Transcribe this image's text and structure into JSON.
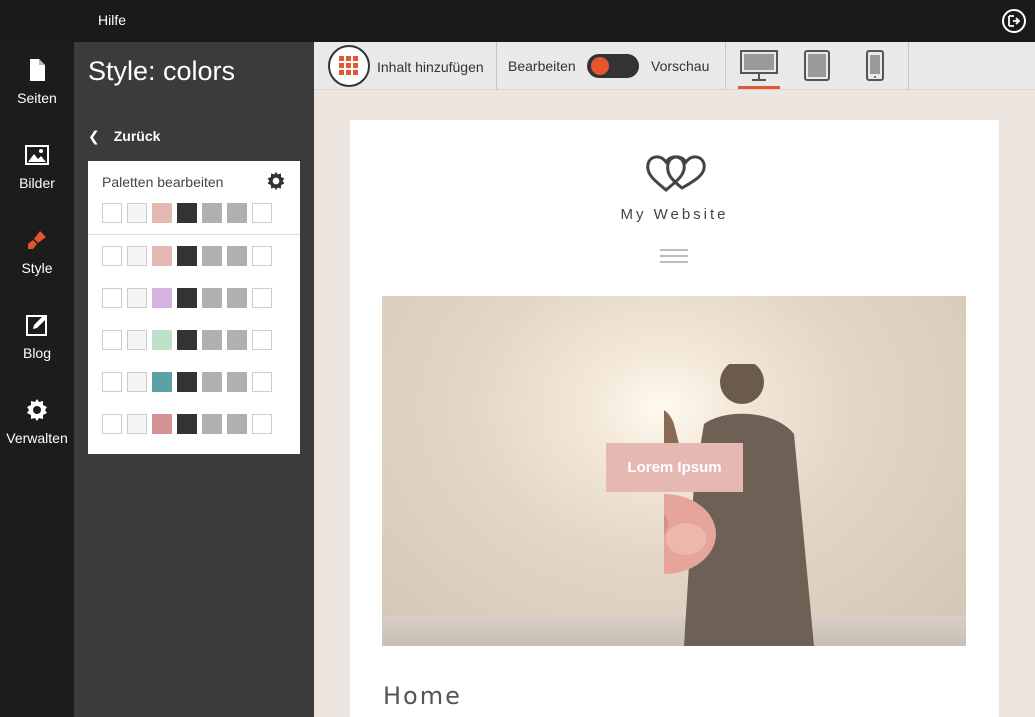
{
  "topbar": {
    "help_label": "Hilfe"
  },
  "nav": {
    "items": [
      {
        "label": "Seiten",
        "icon": "page-icon"
      },
      {
        "label": "Bilder",
        "icon": "image-icon"
      },
      {
        "label": "Style",
        "icon": "brush-icon",
        "active": true
      },
      {
        "label": "Blog",
        "icon": "edit-icon"
      },
      {
        "label": "Verwalten",
        "icon": "gear-icon"
      }
    ]
  },
  "panel": {
    "title": "Style: colors",
    "back_label": "Zurück",
    "palette_header": "Paletten bearbeiten",
    "current_palette": [
      "#ffffff",
      "#f5f5f5",
      "#e5b8b1",
      "#333333",
      "#b0b0b0",
      "#b0b0b0",
      "#ffffff"
    ],
    "palettes": [
      [
        "#ffffff",
        "#f5f5f5",
        "#e5b8b1",
        "#333333",
        "#b0b0b0",
        "#b0b0b0",
        "#ffffff"
      ],
      [
        "#ffffff",
        "#f5f5f5",
        "#d4b3e0",
        "#333333",
        "#b0b0b0",
        "#b0b0b0",
        "#ffffff"
      ],
      [
        "#ffffff",
        "#f5f5f5",
        "#bde0c9",
        "#333333",
        "#b0b0b0",
        "#b0b0b0",
        "#ffffff"
      ],
      [
        "#ffffff",
        "#f5f5f5",
        "#5ba1a6",
        "#333333",
        "#b0b0b0",
        "#b0b0b0",
        "#ffffff"
      ],
      [
        "#ffffff",
        "#f5f5f5",
        "#d39393",
        "#333333",
        "#b0b0b0",
        "#b0b0b0",
        "#ffffff"
      ]
    ]
  },
  "toolbar": {
    "add_content_label": "Inhalt hinzufügen",
    "edit_label": "Bearbeiten",
    "preview_label": "Vorschau",
    "devices": [
      "desktop-icon",
      "tablet-icon",
      "phone-icon"
    ],
    "active_device": "desktop-icon",
    "accent": "#e4572e"
  },
  "site": {
    "name": "My Website",
    "cta_label": "Lorem Ipsum",
    "heading": "Home"
  }
}
